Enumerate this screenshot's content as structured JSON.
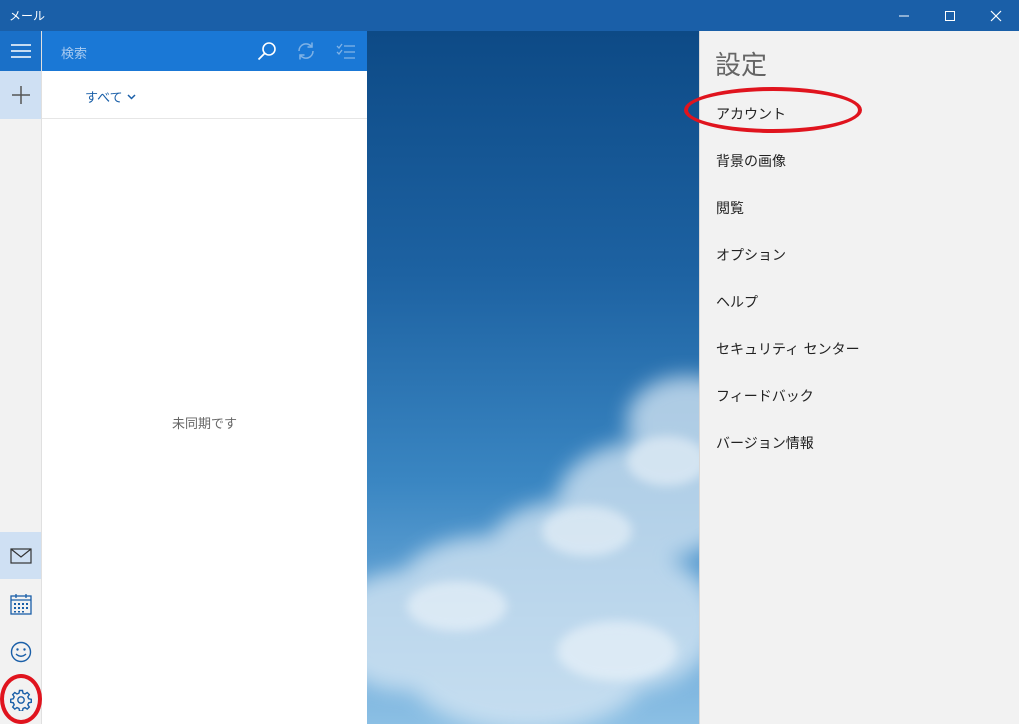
{
  "window": {
    "title": "メール"
  },
  "nav": {
    "items": [
      {
        "icon": "hamburger-menu-icon"
      },
      {
        "icon": "plus-icon"
      },
      {
        "icon": "mail-icon"
      },
      {
        "icon": "calendar-icon"
      },
      {
        "icon": "smiley-icon"
      },
      {
        "icon": "gear-icon"
      }
    ]
  },
  "search": {
    "placeholder": "検索"
  },
  "filter": {
    "label": "すべて"
  },
  "list": {
    "empty_message": "未同期です"
  },
  "settings": {
    "title": "設定",
    "items": [
      {
        "label": "アカウント"
      },
      {
        "label": "背景の画像"
      },
      {
        "label": "閲覧"
      },
      {
        "label": "オプション"
      },
      {
        "label": "ヘルプ"
      },
      {
        "label": "セキュリティ センター"
      },
      {
        "label": "フィードバック"
      },
      {
        "label": "バージョン情報"
      }
    ]
  },
  "colors": {
    "titlebar": "#1a5fa8",
    "accent": "#1a78d6",
    "annotation": "#e0141e"
  }
}
